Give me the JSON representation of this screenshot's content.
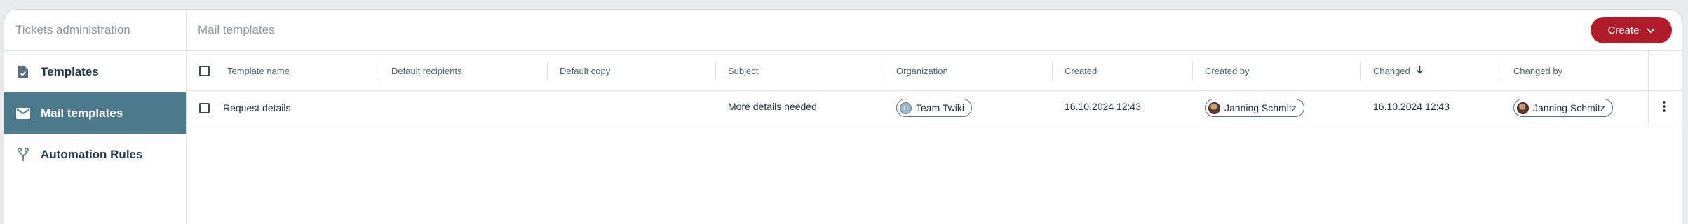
{
  "sidebar": {
    "header": "Tickets administration",
    "items": [
      {
        "label": "Templates",
        "icon": "document-check-icon",
        "active": false
      },
      {
        "label": "Mail templates",
        "icon": "mail-icon",
        "active": true
      },
      {
        "label": "Automation Rules",
        "icon": "fork-icon",
        "active": false
      }
    ]
  },
  "main": {
    "title": "Mail templates",
    "create_label": "Create",
    "columns": [
      "Template name",
      "Default recipients",
      "Default copy",
      "Subject",
      "Organization",
      "Created",
      "Created by",
      "Changed",
      "Changed by"
    ],
    "sort": {
      "column": "Changed",
      "direction": "descending"
    },
    "rows": [
      {
        "template_name": "Request details",
        "default_recipients": "",
        "default_copy": "",
        "subject": "More details needed",
        "organization": "Team Twiki",
        "organization_initials": "TT",
        "created": "16.10.2024 12:43",
        "created_by": "Janning Schmitz",
        "changed": "16.10.2024 12:43",
        "changed_by": "Janning Schmitz"
      }
    ]
  },
  "colors": {
    "accent": "#b01c29",
    "active_nav": "#4a7a8c",
    "background": "#e9eaec"
  }
}
